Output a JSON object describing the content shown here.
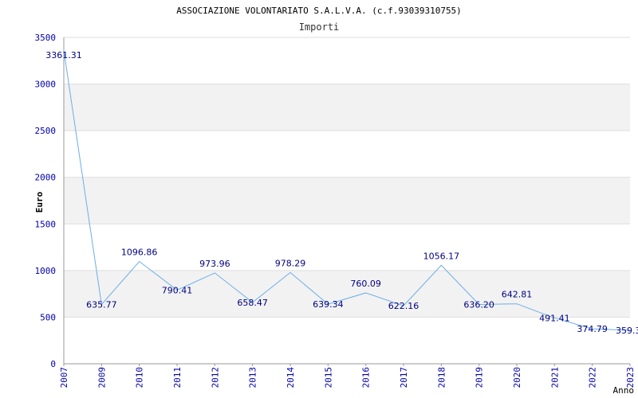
{
  "chart_data": {
    "type": "line",
    "title": "ASSOCIAZIONE VOLONTARIATO S.A.L.V.A. (c.f.93039310755)",
    "subtitle": "Importi",
    "xlabel": "Anno",
    "ylabel": "Euro",
    "ylim": [
      0,
      3500
    ],
    "yticks": [
      0,
      500,
      1000,
      1500,
      2000,
      2500,
      3000,
      3500
    ],
    "grid": "horizontal alternating bands",
    "x": [
      "2007",
      "2009",
      "2010",
      "2011",
      "2012",
      "2013",
      "2014",
      "2015",
      "2016",
      "2017",
      "2018",
      "2019",
      "2020",
      "2021",
      "2022",
      "2023"
    ],
    "labels": [
      "3361.31",
      "635.77",
      "1096.86",
      "790.41",
      "973.96",
      "658.47",
      "978.29",
      "639.34",
      "760.09",
      "622.16",
      "1056.17",
      "636.20",
      "642.81",
      "491.41",
      "374.79",
      "359.3"
    ],
    "series": [
      {
        "values": [
          3361.31,
          635.77,
          1096.86,
          790.41,
          973.96,
          658.47,
          978.29,
          639.34,
          760.09,
          622.16,
          1056.17,
          636.2,
          642.81,
          491.41,
          374.79,
          359.3
        ]
      }
    ],
    "colors": {
      "line": "#6aaee8",
      "axis_text": "#0000aa",
      "label_text": "#000080",
      "band": "#f2f2f2",
      "title": "#000000"
    }
  }
}
